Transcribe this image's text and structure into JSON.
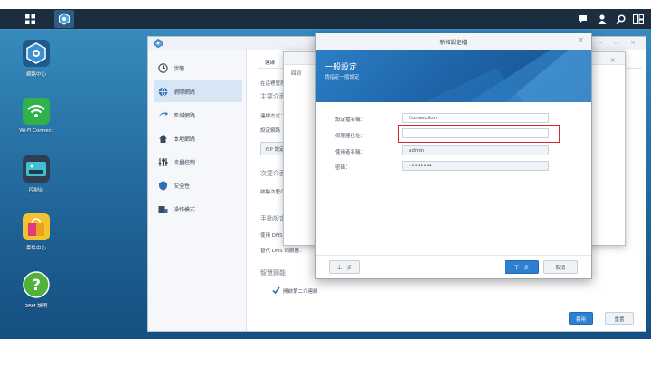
{
  "desktop": {
    "icons": [
      {
        "label": "網路中心"
      },
      {
        "label": "Wi-Fi Connect"
      },
      {
        "label": "控制台"
      },
      {
        "label": "套件中心"
      },
      {
        "label": "SRM 說明"
      }
    ]
  },
  "main_window": {
    "sidebar": [
      {
        "label": "狀態"
      },
      {
        "label": "網際網路"
      },
      {
        "label": "區域網路"
      },
      {
        "label": "本地網路"
      },
      {
        "label": "流量控制"
      },
      {
        "label": "安全性"
      },
      {
        "label": "操作模式"
      }
    ],
    "tab": "連線",
    "texts": {
      "line1": "在這裡管理",
      "section1": "主要介面",
      "conn_type": "連線方式：",
      "ip_mode": "設定網路",
      "isp_btn": "ISP 設定",
      "section2": "次要介面",
      "enable_secondary": "啟動次要介",
      "section3": "手動設定",
      "dns_primary": "使用 DNS",
      "dns_alt": "替代 DNS 伺服器：",
      "section4": "智慧節能",
      "checkbox_label": "開啟第二介連線"
    },
    "apply_label": "套用",
    "reset_label": "重置"
  },
  "back_wizard": {
    "tab": "回到"
  },
  "dialog": {
    "title": "新增設定檔",
    "heading": "一般設定",
    "subheading": "請指定一般設定",
    "fields": [
      {
        "label": "設定檔名稱：",
        "value": "Connection"
      },
      {
        "label": "伺服器位址：",
        "value": ""
      },
      {
        "label": "使用者名稱：",
        "value": "admin"
      },
      {
        "label": "密碼：",
        "value": "••••••••"
      }
    ],
    "back_label": "上一步",
    "next_label": "下一步",
    "cancel_label": "取消"
  },
  "colors": {
    "accent": "#2d7fd2",
    "highlight_border": "#d9272e",
    "taskbar": "#1c2d40"
  }
}
